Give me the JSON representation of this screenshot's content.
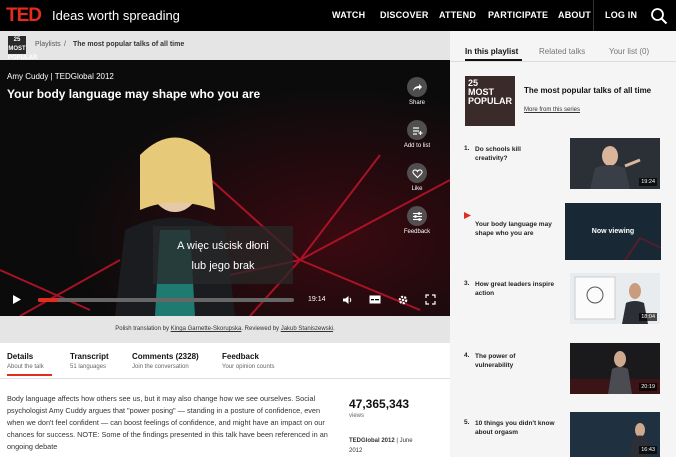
{
  "header": {
    "logo": "TED",
    "tagline": "Ideas worth spreading",
    "nav": [
      "WATCH",
      "DISCOVER",
      "ATTEND",
      "PARTICIPATE",
      "ABOUT",
      "LOG IN"
    ],
    "colors": {
      "brand": "#e62b1e",
      "bar": "#000000"
    }
  },
  "breadcrumb": {
    "thumb_label": "25 MOST POPULAR",
    "link": "Playlists",
    "separator": "/",
    "current": "The most popular talks of all time"
  },
  "video": {
    "speaker_event": "Amy Cuddy | TEDGlobal 2012",
    "title": "Your body language may shape who you are",
    "actions": [
      {
        "label": "Share",
        "icon": "share-icon"
      },
      {
        "label": "Add to list",
        "icon": "add-to-list-icon"
      },
      {
        "label": "Like",
        "icon": "heart-icon"
      },
      {
        "label": "Feedback",
        "icon": "sliders-icon"
      }
    ],
    "subtitle_line1": "A więc uścisk dłoni",
    "subtitle_line2": "lub jego brak",
    "time": "19:14",
    "progress": 0.08
  },
  "translation": {
    "prefix": "Polish translation by ",
    "translator": "Kinga Garnette-Skorupska",
    "middle": ". Reviewed by ",
    "reviewer": "Jakub Staniszewski",
    "suffix": "."
  },
  "tabs": [
    {
      "title": "Details",
      "sub": "About the talk"
    },
    {
      "title": "Transcript",
      "sub": "51 languages"
    },
    {
      "title": "Comments (2328)",
      "sub": "Join the conversation"
    },
    {
      "title": "Feedback",
      "sub": "Your opinion counts"
    }
  ],
  "description": "Body language affects how others see us, but it may also change how we see ourselves. Social psychologist Amy Cuddy argues that \"power posing\" — standing in a posture of confidence, even when we don't feel confident — can boost feelings of confidence, and might have an impact on our chances for success. NOTE: Some of the findings presented in this talk have been referenced in an ongoing debate",
  "stats": {
    "views": "47,365,343",
    "views_label": "views",
    "event": "TEDGlobal 2012",
    "event_sep": " | ",
    "date_part1": "June",
    "date_part2": "2012"
  },
  "right_panel": {
    "tabs": [
      "In this playlist",
      "Related talks",
      "Your list (0)"
    ],
    "playlist_thumb": "25 MOST POPULAR",
    "playlist_title": "The most popular talks of all time",
    "more_link": "More from this series",
    "items": [
      {
        "num": "1.",
        "title": "Do schools kill creativity?",
        "duration": "19:24"
      },
      {
        "num": "",
        "title": "Your body language may shape who you are",
        "duration": "",
        "now": "Now viewing"
      },
      {
        "num": "3.",
        "title": "How great leaders inspire action",
        "duration": "18:04"
      },
      {
        "num": "4.",
        "title": "The power of vulnerability",
        "duration": "20:19"
      },
      {
        "num": "5.",
        "title": "10 things you didn't know about orgasm",
        "duration": "16:43"
      }
    ]
  }
}
